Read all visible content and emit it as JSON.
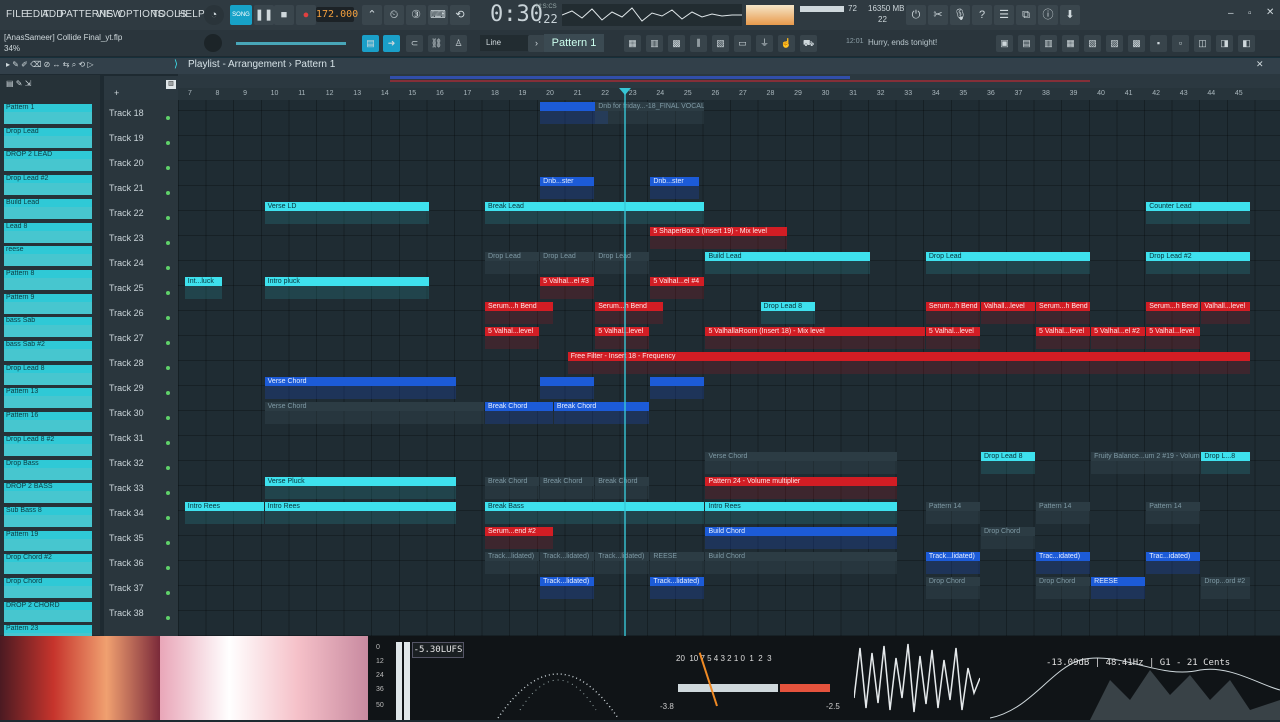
{
  "menu": [
    "FILE",
    "EDIT",
    "ADD",
    "PATTERNS",
    "VIEW",
    "OPTIONS",
    "TOOLS",
    "HELP"
  ],
  "transport": {
    "mode": "SONG",
    "tempo": "172.000",
    "time": "0:30",
    "time_frac": ":22",
    "time_unit": "M:S:CS"
  },
  "perf": {
    "cpu": "72",
    "memory": "16350 MB",
    "voices": "22"
  },
  "project": {
    "name": "[AnasSameer] Collide Final_yt.flp",
    "zoom": "34%"
  },
  "toolbar": {
    "snap": "Line",
    "pattern": "Pattern 1",
    "hint_time": "12:01",
    "hint": "Hurry, ends tonight!"
  },
  "playlist": {
    "title": "Playlist - Arrangement",
    "pattern": "Pattern 1"
  },
  "ruler": [
    "7",
    "8",
    "9",
    "10",
    "11",
    "12",
    "13",
    "14",
    "15",
    "16",
    "17",
    "18",
    "19",
    "20",
    "21",
    "22",
    "23",
    "24",
    "25",
    "26",
    "27",
    "28",
    "29",
    "30",
    "31",
    "32",
    "33",
    "34",
    "35",
    "36",
    "37",
    "38",
    "39",
    "40",
    "41",
    "42",
    "43",
    "44",
    "45"
  ],
  "patterns": [
    "Pattern 1",
    "Drop Lead",
    "DROP 2 LEAD",
    "Drop Lead #2",
    "Build Lead",
    "Lead 8",
    "reese",
    "Pattern 8",
    "Pattern 9",
    "bass Sab",
    "bass Sab #2",
    "Drop Lead 8",
    "Pattern 13",
    "Pattern 16",
    "Drop Lead 8 #2",
    "Drop Bass",
    "DROP 2 BASS",
    "Sub Bass 8",
    "Pattern 19",
    "Drop Chord #2",
    "Drop Chord",
    "DROP 2 CHORD",
    "Pattern 23"
  ],
  "tracks": [
    "Track 18",
    "Track 19",
    "Track 20",
    "Track 21",
    "Track 22",
    "Track 23",
    "Track 24",
    "Track 25",
    "Track 26",
    "Track 27",
    "Track 28",
    "Track 29",
    "Track 30",
    "Track 31",
    "Track 32",
    "Track 33",
    "Track 34",
    "Track 35",
    "Track 36",
    "Track 37",
    "Track 38"
  ],
  "clips": [
    {
      "track": 0,
      "start": 20,
      "len": 2.5,
      "color": "blue",
      "label": ""
    },
    {
      "track": 0,
      "start": 22,
      "len": 4,
      "color": "grey",
      "label": "Dnb for friday...-18_FINAL VOCAL"
    },
    {
      "track": 3,
      "start": 20,
      "len": 2,
      "color": "blue",
      "label": "Dnb...ster"
    },
    {
      "track": 3,
      "start": 24,
      "len": 1.8,
      "color": "blue",
      "label": "Dnb...ster"
    },
    {
      "track": 4,
      "start": 10,
      "len": 6,
      "color": "cyan",
      "label": "Verse LD"
    },
    {
      "track": 4,
      "start": 18,
      "len": 8,
      "color": "cyan",
      "label": "Break Lead"
    },
    {
      "track": 4,
      "start": 42,
      "len": 3.8,
      "color": "cyan",
      "label": "Counter Lead"
    },
    {
      "track": 5,
      "start": 24,
      "len": 5,
      "color": "red",
      "label": "5 ShaperBox 3 (Insert 19) - Mix level"
    },
    {
      "track": 6,
      "start": 18,
      "len": 2,
      "color": "grey",
      "label": "Drop Lead"
    },
    {
      "track": 6,
      "start": 20,
      "len": 2,
      "color": "grey",
      "label": "Drop Lead"
    },
    {
      "track": 6,
      "start": 22,
      "len": 2,
      "color": "grey",
      "label": "Drop Lead"
    },
    {
      "track": 6,
      "start": 26,
      "len": 6,
      "color": "cyan",
      "label": "Build Lead"
    },
    {
      "track": 6,
      "start": 34,
      "len": 6,
      "color": "cyan",
      "label": "Drop Lead"
    },
    {
      "track": 6,
      "start": 42,
      "len": 3.8,
      "color": "cyan",
      "label": "Drop Lead #2"
    },
    {
      "track": 7,
      "start": 7.1,
      "len": 1.4,
      "color": "cyan",
      "label": "Int...luck"
    },
    {
      "track": 7,
      "start": 10,
      "len": 6,
      "color": "cyan",
      "label": "Intro pluck"
    },
    {
      "track": 7,
      "start": 20,
      "len": 2,
      "color": "red",
      "label": "5 Valhal...el #3"
    },
    {
      "track": 7,
      "start": 24,
      "len": 2,
      "color": "red",
      "label": "5 Valhal...el #4"
    },
    {
      "track": 8,
      "start": 18,
      "len": 2.5,
      "color": "red",
      "label": "Serum...h Bend"
    },
    {
      "track": 8,
      "start": 22,
      "len": 2.5,
      "color": "red",
      "label": "Serum...h Bend"
    },
    {
      "track": 8,
      "start": 28,
      "len": 2,
      "color": "cyan",
      "label": "Drop Lead 8"
    },
    {
      "track": 8,
      "start": 34,
      "len": 2,
      "color": "red",
      "label": "Serum...h Bend"
    },
    {
      "track": 8,
      "start": 36,
      "len": 2,
      "color": "red",
      "label": "Valhall...level"
    },
    {
      "track": 8,
      "start": 38,
      "len": 2,
      "color": "red",
      "label": "Serum...h Bend"
    },
    {
      "track": 8,
      "start": 42,
      "len": 2,
      "color": "red",
      "label": "Serum...h Bend"
    },
    {
      "track": 8,
      "start": 44,
      "len": 1.8,
      "color": "red",
      "label": "Valhall...level"
    },
    {
      "track": 9,
      "start": 18,
      "len": 2,
      "color": "red",
      "label": "5 Valhal...level"
    },
    {
      "track": 9,
      "start": 22,
      "len": 2,
      "color": "red",
      "label": "5 Valhal...level"
    },
    {
      "track": 9,
      "start": 26,
      "len": 8,
      "color": "red",
      "label": "5 ValhallaRoom (Insert 18) - Mix level"
    },
    {
      "track": 9,
      "start": 34,
      "len": 2,
      "color": "red",
      "label": "5 Valhal...level"
    },
    {
      "track": 9,
      "start": 38,
      "len": 2,
      "color": "red",
      "label": "5 Valhal...level"
    },
    {
      "track": 9,
      "start": 40,
      "len": 2,
      "color": "red",
      "label": "5 Valhal...el #2"
    },
    {
      "track": 9,
      "start": 42,
      "len": 2,
      "color": "red",
      "label": "5 Valhal...level"
    },
    {
      "track": 10,
      "start": 21,
      "len": 24.8,
      "color": "red",
      "label": "Free Filter - Insert 18 - Frequency"
    },
    {
      "track": 11,
      "start": 10,
      "len": 7,
      "color": "blue",
      "label": "Verse Chord"
    },
    {
      "track": 11,
      "start": 20,
      "len": 2,
      "color": "blue",
      "label": ""
    },
    {
      "track": 11,
      "start": 24,
      "len": 2,
      "color": "blue",
      "label": ""
    },
    {
      "track": 12,
      "start": 10,
      "len": 8,
      "color": "grey",
      "label": "Verse Chord"
    },
    {
      "track": 12,
      "start": 18,
      "len": 2.5,
      "color": "blue",
      "label": "Break Chord"
    },
    {
      "track": 12,
      "start": 20.5,
      "len": 3.5,
      "color": "blue",
      "label": "Break Chord"
    },
    {
      "track": 14,
      "start": 26,
      "len": 7,
      "color": "grey",
      "label": "Verse Chord"
    },
    {
      "track": 14,
      "start": 36,
      "len": 2,
      "color": "cyan",
      "label": "Drop Lead 8"
    },
    {
      "track": 14,
      "start": 40,
      "len": 4,
      "color": "grey",
      "label": "Fruity Balance...um 2 #19 - Volume"
    },
    {
      "track": 14,
      "start": 44,
      "len": 1.8,
      "color": "cyan",
      "label": "Drop L...8"
    },
    {
      "track": 15,
      "start": 10,
      "len": 7,
      "color": "cyan",
      "label": "Verse Pluck"
    },
    {
      "track": 15,
      "start": 18,
      "len": 2,
      "color": "grey",
      "label": "Break Chord"
    },
    {
      "track": 15,
      "start": 20,
      "len": 2,
      "color": "grey",
      "label": "Break Chord"
    },
    {
      "track": 15,
      "start": 22,
      "len": 2,
      "color": "grey",
      "label": "Break Chord"
    },
    {
      "track": 15,
      "start": 26,
      "len": 7,
      "color": "red",
      "label": "Pattern 24 - Volume multiplier"
    },
    {
      "track": 16,
      "start": 7.1,
      "len": 2.9,
      "color": "cyan",
      "label": "Intro Rees"
    },
    {
      "track": 16,
      "start": 10,
      "len": 7,
      "color": "cyan",
      "label": "Intro Rees"
    },
    {
      "track": 16,
      "start": 18,
      "len": 8,
      "color": "cyan",
      "label": "Break Bass"
    },
    {
      "track": 16,
      "start": 26,
      "len": 7,
      "color": "cyan",
      "label": "Intro Rees"
    },
    {
      "track": 16,
      "start": 34,
      "len": 2,
      "color": "grey",
      "label": "Pattern 14"
    },
    {
      "track": 16,
      "start": 38,
      "len": 2,
      "color": "grey",
      "label": "Pattern 14"
    },
    {
      "track": 16,
      "start": 42,
      "len": 2,
      "color": "grey",
      "label": "Pattern 14"
    },
    {
      "track": 17,
      "start": 18,
      "len": 2.5,
      "color": "red",
      "label": "Serum...end #2"
    },
    {
      "track": 17,
      "start": 26,
      "len": 7,
      "color": "blue",
      "label": "Build Chord"
    },
    {
      "track": 17,
      "start": 36,
      "len": 2,
      "color": "grey",
      "label": "Drop Chord"
    },
    {
      "track": 18,
      "start": 18,
      "len": 2,
      "color": "grey",
      "label": "Track...lidated)"
    },
    {
      "track": 18,
      "start": 20,
      "len": 2,
      "color": "grey",
      "label": "Track...lidated)"
    },
    {
      "track": 18,
      "start": 22,
      "len": 2,
      "color": "grey",
      "label": "Track...lidated)"
    },
    {
      "track": 18,
      "start": 24,
      "len": 2,
      "color": "grey",
      "label": "REESE"
    },
    {
      "track": 18,
      "start": 26,
      "len": 7,
      "color": "grey",
      "label": "Build Chord"
    },
    {
      "track": 18,
      "start": 34,
      "len": 2,
      "color": "blue",
      "label": "Track...lidated)"
    },
    {
      "track": 18,
      "start": 38,
      "len": 2,
      "color": "blue",
      "label": "Trac...idated)"
    },
    {
      "track": 18,
      "start": 42,
      "len": 2,
      "color": "blue",
      "label": "Trac...idated)"
    },
    {
      "track": 19,
      "start": 20,
      "len": 2,
      "color": "blue",
      "label": "Track...lidated)"
    },
    {
      "track": 19,
      "start": 24,
      "len": 2,
      "color": "blue",
      "label": "Track...lidated)"
    },
    {
      "track": 19,
      "start": 34,
      "len": 2,
      "color": "grey",
      "label": "Drop Chord"
    },
    {
      "track": 19,
      "start": 38,
      "len": 2,
      "color": "grey",
      "label": "Drop Chord"
    },
    {
      "track": 19,
      "start": 40,
      "len": 2,
      "color": "blue",
      "label": "REESE"
    },
    {
      "track": 19,
      "start": 44,
      "len": 1.8,
      "color": "grey",
      "label": "Drop...ord #2"
    }
  ],
  "meters": {
    "lufs": "-5.30LUFS",
    "lufs_scale": [
      "0",
      "12",
      "24",
      "36",
      "50"
    ],
    "vu_left": "-3.8",
    "vu_right": "-2.5",
    "vu_scale": "20  10 7 5 4 3 2 1 0  1  2  3",
    "tuner": "-13.09dB | 48.41Hz | G1 - 21 Cents"
  },
  "colors": {
    "cyan": "#3ee1ee",
    "blue": "#1c5bd8",
    "red": "#d21d24",
    "accent": "#f29f3e"
  }
}
